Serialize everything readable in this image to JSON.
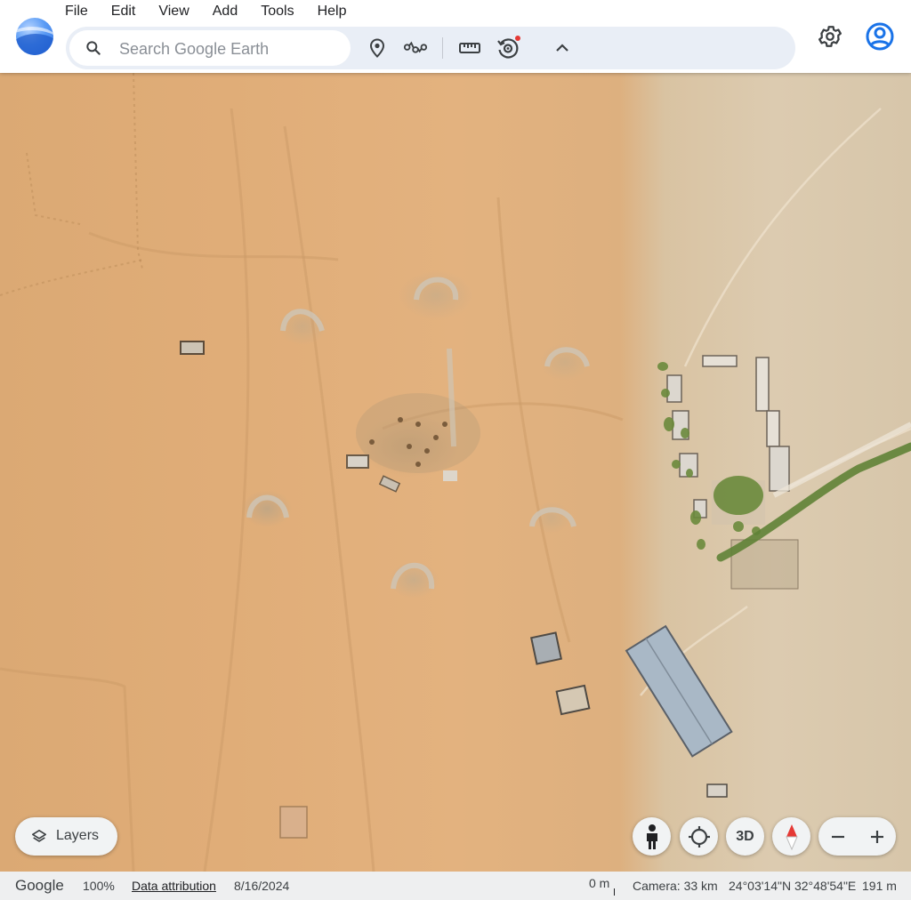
{
  "menu": {
    "items": [
      {
        "label": "File"
      },
      {
        "label": "Edit"
      },
      {
        "label": "View"
      },
      {
        "label": "Add"
      },
      {
        "label": "Tools"
      },
      {
        "label": "Help"
      }
    ]
  },
  "search": {
    "placeholder": "Search Google Earth",
    "value": ""
  },
  "toolbar": {
    "icons": [
      "add-placemark-icon",
      "path-icon",
      "ruler-icon",
      "history-icon",
      "chevron-up-icon"
    ],
    "history_notification": true,
    "accent_color": "#e53935"
  },
  "header_right": {
    "icons": [
      "gear-icon",
      "account-icon"
    ],
    "account_color": "#1a73e8"
  },
  "map": {
    "imagery": "satellite"
  },
  "controls": {
    "layers_label": "Layers",
    "three_d_label": "3D",
    "icons": [
      "pegman-icon",
      "my-location-icon",
      "compass-icon",
      "zoom-out-icon",
      "zoom-in-icon"
    ]
  },
  "status": {
    "brand": "Google",
    "zoom_percent": "100%",
    "data_attribution": "Data attribution",
    "imagery_date": "8/16/2024",
    "scale_label": "0 m",
    "camera": "Camera: 33 km",
    "coordinates": "24°03'14\"N 32°48'54\"E",
    "elevation": "191 m"
  }
}
